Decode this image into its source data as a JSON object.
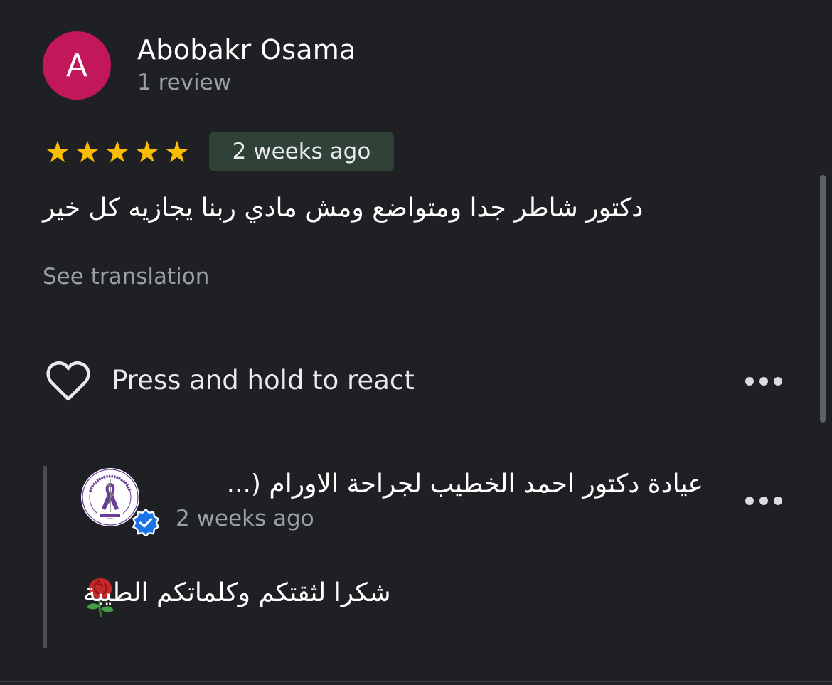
{
  "review": {
    "author": {
      "initial": "A",
      "name": "Abobakr Osama",
      "review_count": "1 review",
      "avatar_color": "#c2185b"
    },
    "rating": 5,
    "max_rating": 5,
    "stars": [
      "★",
      "★",
      "★",
      "★",
      "★"
    ],
    "time": "2 weeks ago",
    "text": "دكتور شاطر جدا ومتواضع ومش مادي ربنا يجازيه كل خير",
    "translate_label": "See translation",
    "react_label": "Press and hold to react",
    "heart_icon": "heart-outline-icon",
    "more_icon": "more-horizontal-icon"
  },
  "owner_reply": {
    "name": "عيادة دكتور احمد الخطيب لجراحة الاورام (...",
    "time": "2 weeks ago",
    "text": "شكرا لثقتكم وكلماتكم الطيبة",
    "emoji_icon": "rose-icon",
    "logo_caption": "AKCCC",
    "logo_ring_text": "Dr. Ahmed ElKhatib Comprehensive Cancer Center",
    "verified_icon": "verified-check-icon"
  },
  "colors": {
    "background": "#1f2024",
    "star": "#fbbc04",
    "badge_bg": "#304238",
    "muted_text": "#9aa0a6",
    "verified": "#1a73e8",
    "logo_ribbon": "#6a3d9a"
  }
}
